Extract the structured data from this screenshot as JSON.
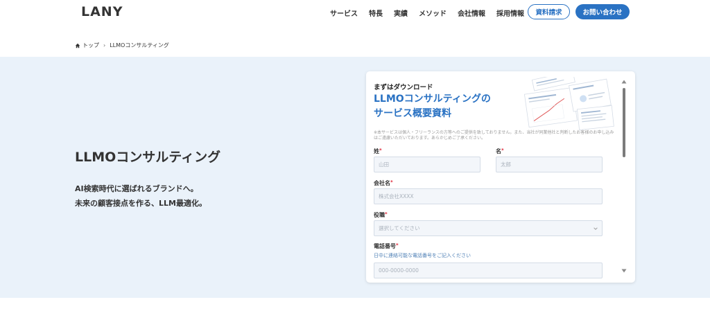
{
  "header": {
    "logo": "LANY",
    "nav": [
      "サービス",
      "特長",
      "実績",
      "メソッド",
      "会社情報",
      "採用情報"
    ],
    "cta_outline": "資料請求",
    "cta_fill": "お問い合わせ"
  },
  "breadcrumb": {
    "home": "トップ",
    "current": "LLMOコンサルティング"
  },
  "hero": {
    "title": "LLMOコンサルティング",
    "lead_line1": "AI検索時代に選ばれるブランドへ。",
    "lead_line2": "未来の顧客接点を作る、LLM最適化。"
  },
  "form": {
    "kicker": "まずはダウンロード",
    "title_line1": "LLMOコンサルティングの",
    "title_line2": "サービス概要資料",
    "notice": "※本サービスは個人・フリーランスの方等へのご提供を致しておりません。また、当社が同業他社と判断したお客様のお申し込みはご遠慮いただいております。あらかじめご了承ください。",
    "last_name_label": "姓",
    "last_name_placeholder": "山田",
    "first_name_label": "名",
    "first_name_placeholder": "太郎",
    "company_label": "会社名",
    "company_placeholder": "株式会社XXXX",
    "position_label": "役職",
    "position_placeholder": "選択してください",
    "phone_label": "電話番号",
    "phone_hint": "日中に連絡可能な電話番号をご記入ください",
    "phone_placeholder": "000-0000-0000",
    "required_mark": "*"
  },
  "colors": {
    "accent": "#2a72c3",
    "hero_bg": "#eaf2fa",
    "required": "#dd2233"
  }
}
